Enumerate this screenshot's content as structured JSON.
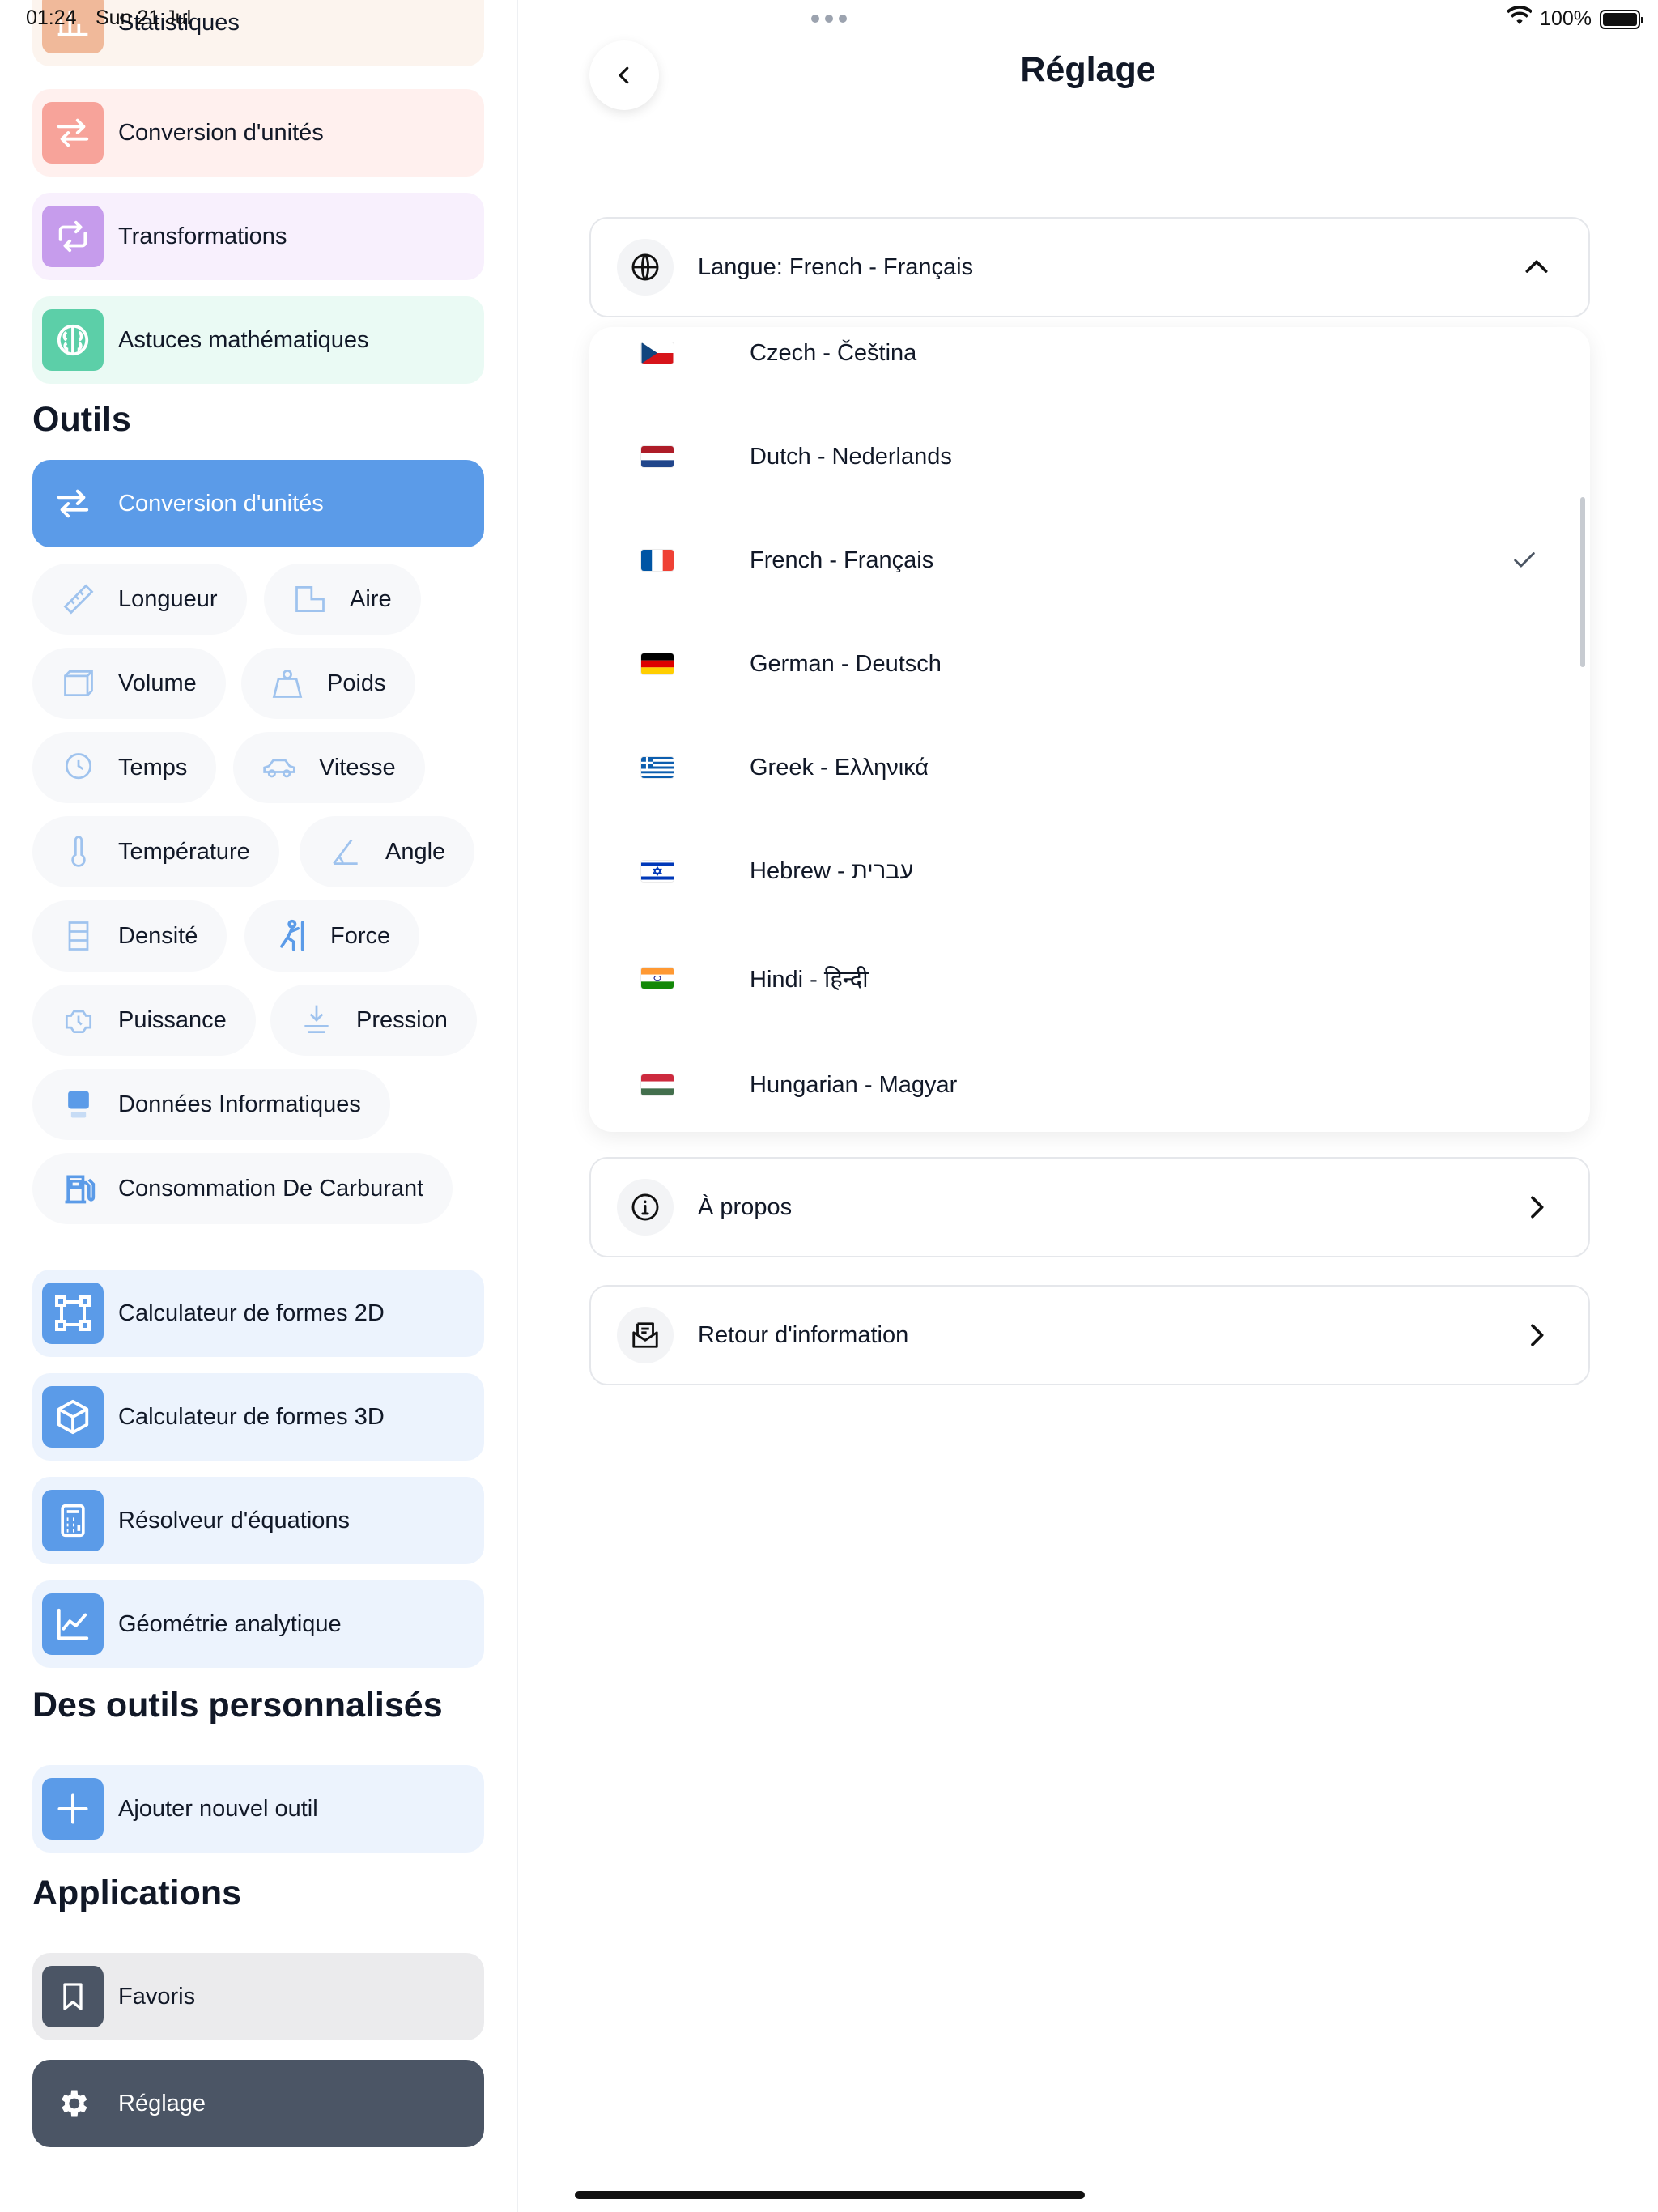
{
  "status": {
    "time": "01:24",
    "date": "Sun 21 Jul",
    "battery": "100%",
    "battery_level": 1.0
  },
  "colors": {
    "primary_blue": "#5b9be8",
    "tile_blue": "#5b9be8",
    "tile_orange": "#f0b99a",
    "tile_pink": "#f7a39a",
    "tile_purple": "#c69cec",
    "tile_green": "#5ccfa8",
    "tile_dark": "#4b5565",
    "chip_bg": "#f7f8fa"
  },
  "sidebar": {
    "top_items": [
      {
        "label": "Statistiques",
        "icon": "chart-icon"
      },
      {
        "label": "Conversion d'unités",
        "icon": "swap-arrows-icon"
      },
      {
        "label": "Transformations",
        "icon": "transform-icon"
      },
      {
        "label": "Astuces mathématiques",
        "icon": "brain-icon"
      }
    ],
    "tools_title": "Outils",
    "tools_active": {
      "label": "Conversion d'unités",
      "icon": "swap-arrows-icon"
    },
    "units": [
      {
        "label": "Longueur",
        "icon": "ruler-icon"
      },
      {
        "label": "Aire",
        "icon": "area-icon"
      },
      {
        "label": "Volume",
        "icon": "volume-icon"
      },
      {
        "label": "Poids",
        "icon": "weight-icon"
      },
      {
        "label": "Temps",
        "icon": "clock-icon"
      },
      {
        "label": "Vitesse",
        "icon": "car-speed-icon"
      },
      {
        "label": "Température",
        "icon": "thermometer-icon"
      },
      {
        "label": "Angle",
        "icon": "angle-icon"
      },
      {
        "label": "Densité",
        "icon": "density-icon"
      },
      {
        "label": "Force",
        "icon": "force-icon"
      },
      {
        "label": "Puissance",
        "icon": "engine-icon"
      },
      {
        "label": "Pression",
        "icon": "pressure-icon"
      },
      {
        "label": "Données Informatiques",
        "icon": "data-icon"
      },
      {
        "label": "Consommation De Carburant",
        "icon": "fuel-icon"
      }
    ],
    "calculators": [
      {
        "label": "Calculateur de formes 2D",
        "icon": "shape-2d-icon"
      },
      {
        "label": "Calculateur de formes 3D",
        "icon": "cube-icon"
      },
      {
        "label": "Résolveur d'équations",
        "icon": "calculator-icon"
      },
      {
        "label": "Géométrie analytique",
        "icon": "line-chart-icon"
      }
    ],
    "custom_title": "Des outils personnalisés",
    "add_tool": {
      "label": "Ajouter nouvel outil",
      "icon": "plus-icon"
    },
    "apps_title": "Applications",
    "favorites": {
      "label": "Favoris",
      "icon": "bookmark-icon"
    },
    "settings": {
      "label": "Réglage",
      "icon": "gear-icon"
    }
  },
  "main": {
    "title": "Réglage",
    "language_row": {
      "label": "Langue: French - Français",
      "icon": "globe-icon"
    },
    "languages": [
      {
        "name": "Czech - Čeština",
        "flag": "cz",
        "selected": false
      },
      {
        "name": "Dutch - Nederlands",
        "flag": "nl",
        "selected": false
      },
      {
        "name": "French - Français",
        "flag": "fr",
        "selected": true
      },
      {
        "name": "German - Deutsch",
        "flag": "de",
        "selected": false
      },
      {
        "name": "Greek - Ελληνικά",
        "flag": "gr",
        "selected": false
      },
      {
        "name": "Hebrew - עברית",
        "flag": "il",
        "selected": false
      },
      {
        "name": "Hindi - हिन्दी",
        "flag": "in",
        "selected": false
      },
      {
        "name": "Hungarian - Magyar",
        "flag": "hu",
        "selected": false
      }
    ],
    "about_row": {
      "label": "À propos",
      "icon": "info-icon"
    },
    "feedback_row": {
      "label": "Retour d'information",
      "icon": "feedback-icon"
    }
  }
}
